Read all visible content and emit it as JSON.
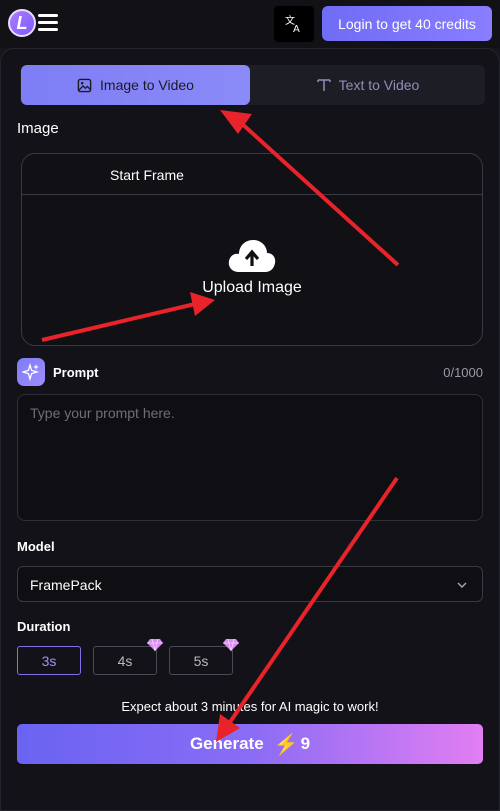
{
  "header": {
    "logo_letter": "L",
    "login_label": "Login to get 40 credits"
  },
  "tabs": [
    {
      "label": "Image to Video",
      "active": true
    },
    {
      "label": "Text to Video",
      "active": false
    }
  ],
  "image_section": {
    "label": "Image",
    "frame_title": "Start Frame",
    "upload_label": "Upload Image"
  },
  "prompt": {
    "label": "Prompt",
    "counter": "0/1000",
    "placeholder": "Type your prompt here.",
    "value": ""
  },
  "model": {
    "label": "Model",
    "selected": "FramePack"
  },
  "duration": {
    "label": "Duration",
    "options": [
      {
        "label": "3s",
        "selected": true,
        "premium": false
      },
      {
        "label": "4s",
        "selected": false,
        "premium": true
      },
      {
        "label": "5s",
        "selected": false,
        "premium": true
      }
    ]
  },
  "expect_text": "Expect about 3 minutes for AI magic to work!",
  "generate": {
    "label": "Generate",
    "cost": "9"
  },
  "colors": {
    "accent": "#7e7ef5",
    "annotation_arrow": "#e8232a",
    "bolt": "#f2c230"
  },
  "icons": [
    "menu-icon",
    "translate-icon",
    "image-icon",
    "text-icon",
    "cloud-upload-icon",
    "sparkle-icon",
    "chevron-down-icon",
    "gem-icon",
    "bolt-icon"
  ]
}
